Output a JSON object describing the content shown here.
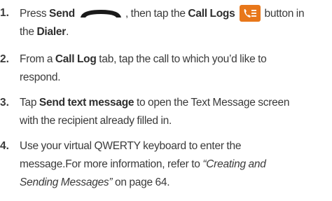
{
  "steps": [
    {
      "number": "1.",
      "t1": "Press ",
      "send_bold": "Send",
      "t2": ", then tap the ",
      "calllogs_bold": "Call Logs",
      "t3": "button in",
      "t4": "the ",
      "dialer_bold": "Dialer",
      "t5": "."
    },
    {
      "number": "2.",
      "t1": "From a ",
      "calllog_bold": "Call Log",
      "t2": " tab, tap the call to which you’d like to",
      "t3": "respond."
    },
    {
      "number": "3.",
      "t1": "Tap ",
      "sendtext_bold": "Send text message",
      "t2": " to open the Text Message screen",
      "t3": "with the recipient already filled in."
    },
    {
      "number": "4.",
      "t1": "Use your virtual QWERTY keyboard to enter the",
      "t2": "message.For more information, refer to ",
      "ref_italic_1": "“Creating and",
      "ref_italic_2": "Sending Messages”",
      "t3": " on page 64."
    }
  ],
  "icons": {
    "send_key": "send-key-icon",
    "call_logs": "call-logs-icon",
    "call_logs_bg": "#e8771a",
    "send_key_color": "#1a1a1a"
  }
}
